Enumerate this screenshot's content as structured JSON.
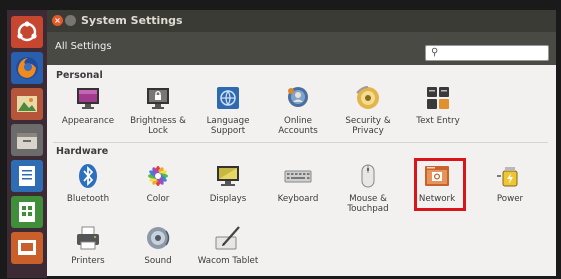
{
  "window": {
    "title": "System Settings",
    "close_glyph": "×"
  },
  "toolbar": {
    "all_settings": "All Settings",
    "search_placeholder": "",
    "search_glyph": "⚲"
  },
  "sections": {
    "personal": {
      "label": "Personal",
      "items": [
        {
          "label1": "Appearance",
          "label2": "",
          "icon": "appearance-icon"
        },
        {
          "label1": "Brightness &",
          "label2": "Lock",
          "icon": "brightness-lock-icon"
        },
        {
          "label1": "Language",
          "label2": "Support",
          "icon": "language-icon"
        },
        {
          "label1": "Online",
          "label2": "Accounts",
          "icon": "online-accounts-icon"
        },
        {
          "label1": "Security &",
          "label2": "Privacy",
          "icon": "security-privacy-icon"
        },
        {
          "label1": "Text Entry",
          "label2": "",
          "icon": "text-entry-icon"
        }
      ]
    },
    "hardware": {
      "label": "Hardware",
      "items": [
        {
          "label1": "Bluetooth",
          "label2": "",
          "icon": "bluetooth-icon"
        },
        {
          "label1": "Color",
          "label2": "",
          "icon": "color-icon"
        },
        {
          "label1": "Displays",
          "label2": "",
          "icon": "displays-icon"
        },
        {
          "label1": "Keyboard",
          "label2": "",
          "icon": "keyboard-icon"
        },
        {
          "label1": "Mouse &",
          "label2": "Touchpad",
          "icon": "mouse-icon"
        },
        {
          "label1": "Network",
          "label2": "",
          "icon": "network-icon",
          "highlighted": true
        },
        {
          "label1": "Power",
          "label2": "",
          "icon": "power-icon"
        }
      ]
    },
    "system": {
      "items": [
        {
          "label1": "Printers",
          "label2": "",
          "icon": "printer-icon"
        },
        {
          "label1": "Sound",
          "label2": "",
          "icon": "sound-icon"
        },
        {
          "label1": "Wacom Tablet",
          "label2": "",
          "icon": "wacom-tablet-icon"
        }
      ]
    }
  },
  "launcher": [
    {
      "name": "ubuntu-dash-icon"
    },
    {
      "name": "firefox-icon"
    },
    {
      "name": "photos-icon"
    },
    {
      "name": "files-icon"
    },
    {
      "name": "writer-icon"
    },
    {
      "name": "calc-icon"
    },
    {
      "name": "impress-icon"
    }
  ],
  "colors": {
    "highlight": "#d9141b",
    "launcher_bg": "#3c2a34",
    "window_bg": "#f2f1f0",
    "titlebar": "#3b3b36"
  }
}
